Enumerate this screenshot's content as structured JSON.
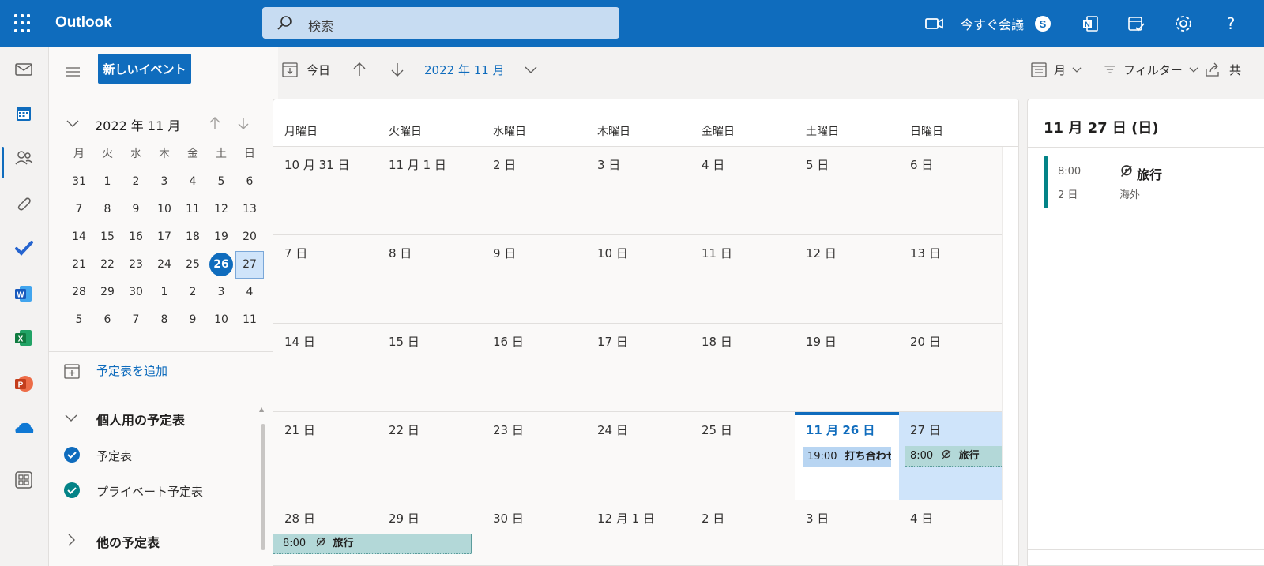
{
  "app": {
    "name": "Outlook"
  },
  "search": {
    "placeholder": "検索"
  },
  "topbar": {
    "meet_now": "今すぐ会議"
  },
  "sidebar": {
    "new_event": "新しいイベント",
    "mini_title": "2022 年 11 月",
    "dow": [
      "月",
      "火",
      "水",
      "木",
      "金",
      "土",
      "日"
    ],
    "weeks": [
      [
        "31",
        "1",
        "2",
        "3",
        "4",
        "5",
        "6"
      ],
      [
        "7",
        "8",
        "9",
        "10",
        "11",
        "12",
        "13"
      ],
      [
        "14",
        "15",
        "16",
        "17",
        "18",
        "19",
        "20"
      ],
      [
        "21",
        "22",
        "23",
        "24",
        "25",
        "26",
        "27"
      ],
      [
        "28",
        "29",
        "30",
        "1",
        "2",
        "3",
        "4"
      ],
      [
        "5",
        "6",
        "7",
        "8",
        "9",
        "10",
        "11"
      ]
    ],
    "add_calendar": "予定表を追加",
    "personal_group": "個人用の予定表",
    "calendars": [
      "予定表",
      "プライベート予定表"
    ],
    "other_group": "他の予定表"
  },
  "toolbar": {
    "today": "今日",
    "range": "2022 年 11 月",
    "view": "月",
    "filter": "フィルター",
    "share": "共"
  },
  "month": {
    "dow": [
      "月曜日",
      "火曜日",
      "水曜日",
      "木曜日",
      "金曜日",
      "土曜日",
      "日曜日"
    ],
    "weeks": [
      [
        "10 月 31 日",
        "11 月 1 日",
        "2 日",
        "3 日",
        "4 日",
        "5 日",
        "6 日"
      ],
      [
        "7 日",
        "8 日",
        "9 日",
        "10 日",
        "11 日",
        "12 日",
        "13 日"
      ],
      [
        "14 日",
        "15 日",
        "16 日",
        "17 日",
        "18 日",
        "19 日",
        "20 日"
      ],
      [
        "21 日",
        "22 日",
        "23 日",
        "24 日",
        "25 日",
        "11 月 26 日",
        "27 日"
      ],
      [
        "28 日",
        "29 日",
        "30 日",
        "12 月 1 日",
        "2 日",
        "3 日",
        "4 日"
      ]
    ],
    "events": {
      "meeting": {
        "time": "19:00",
        "title": "打ち合わせ"
      },
      "trip_27": {
        "time": "8:00",
        "title": "旅行"
      },
      "trip_28": {
        "time": "8:00",
        "title": "旅行"
      }
    }
  },
  "agenda": {
    "date": "11 月 27 日 (日)",
    "event": {
      "time": "8:00",
      "duration": "2 日",
      "title": "旅行",
      "location": "海外"
    }
  },
  "colors": {
    "brand": "#0f6cbd",
    "trip": "#038387",
    "selected": "#cfe4fa"
  }
}
